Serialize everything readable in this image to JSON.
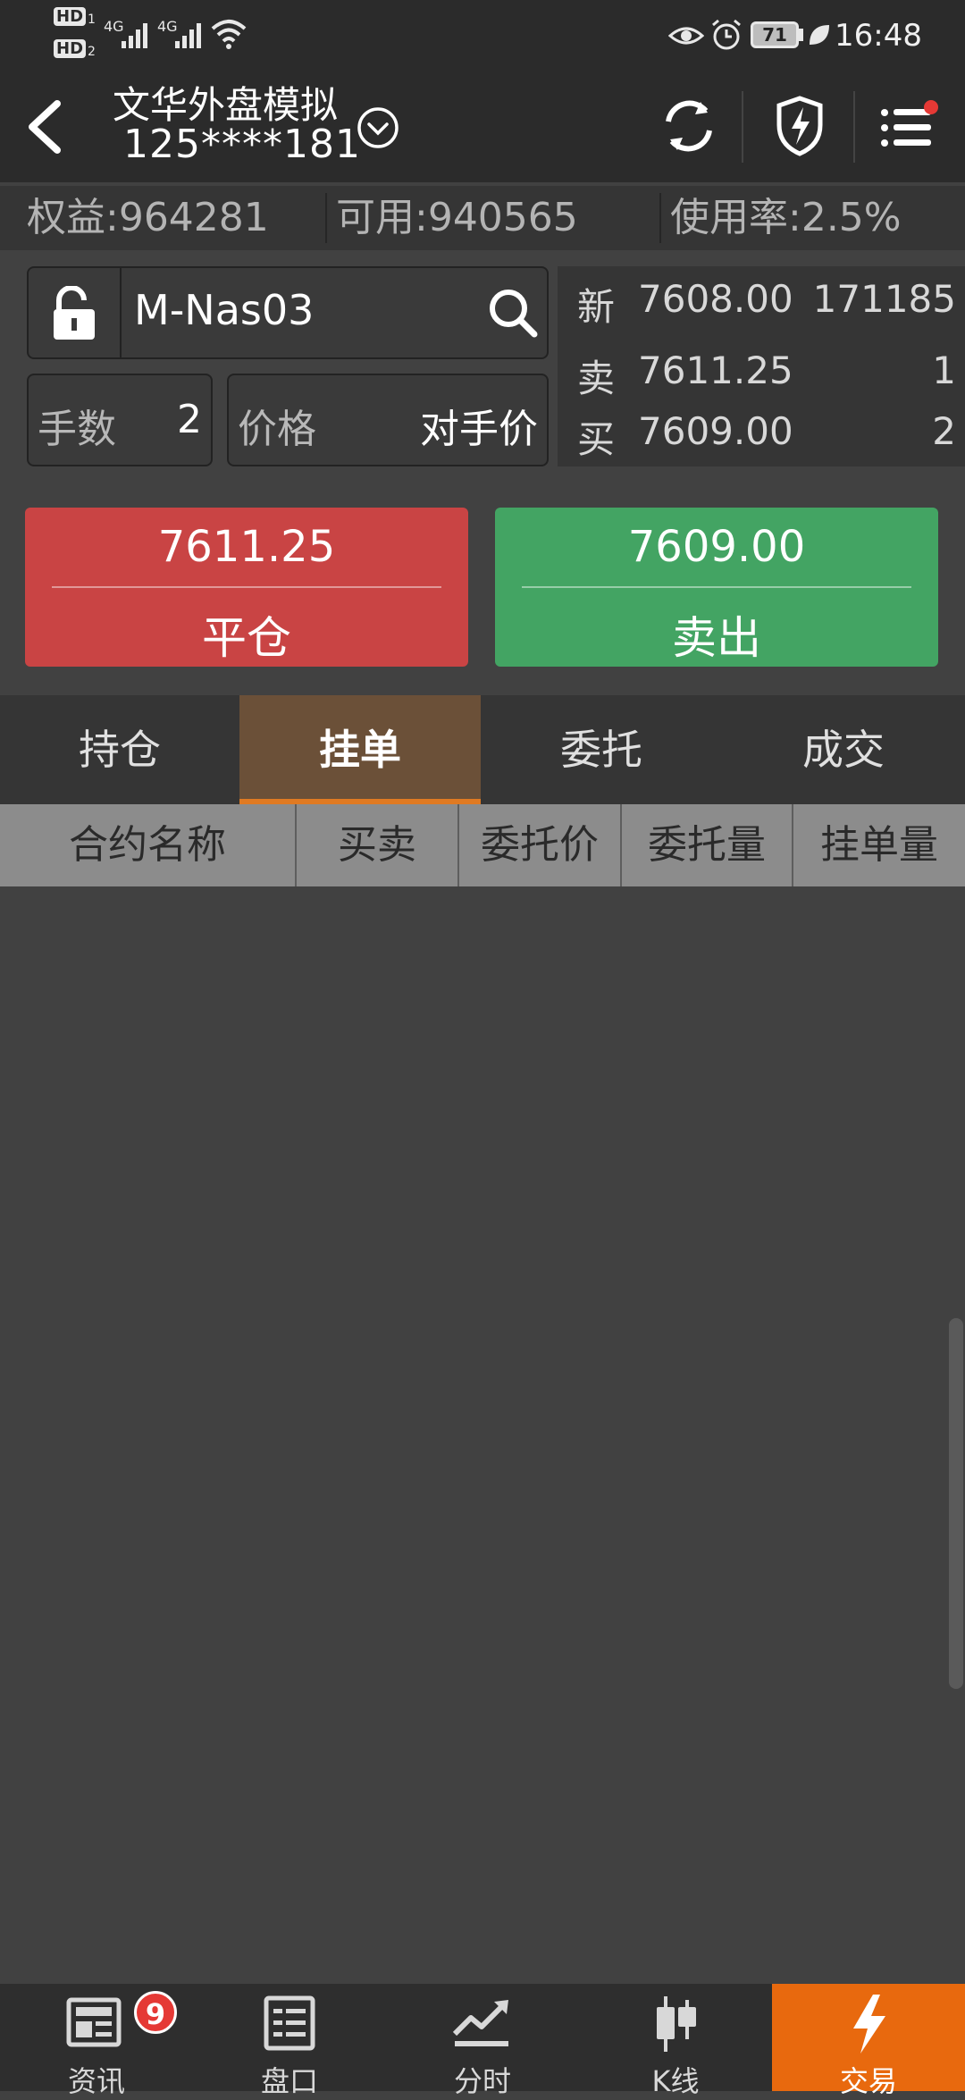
{
  "status_bar": {
    "hd1": "HD",
    "hd1_sub": "1",
    "hd2": "HD",
    "hd2_sub": "2",
    "net1": "4G",
    "net2": "4G",
    "battery": "71",
    "time": "16:48"
  },
  "header": {
    "title": "文华外盘模拟",
    "account": "125****181"
  },
  "account_bar": {
    "equity": "权益:964281",
    "available": "可用:940565",
    "usage": "使用率:2.5%"
  },
  "order": {
    "symbol": "M-Nas03",
    "lots_label": "手数",
    "lots_value": "2",
    "price_label": "价格",
    "price_value": "对手价"
  },
  "quote": {
    "last_label": "新",
    "last_price": "7608.00",
    "volume": "171185",
    "ask_label": "卖",
    "ask_price": "7611.25",
    "ask_qty": "1",
    "bid_label": "买",
    "bid_price": "7609.00",
    "bid_qty": "2"
  },
  "buttons": {
    "close_price": "7611.25",
    "close_label": "平仓",
    "sell_price": "7609.00",
    "sell_label": "卖出"
  },
  "tabs": [
    {
      "label": "持仓"
    },
    {
      "label": "挂单"
    },
    {
      "label": "委托"
    },
    {
      "label": "成交"
    }
  ],
  "active_tab": "挂单",
  "table": {
    "columns": [
      "合约名称",
      "买卖",
      "委托价",
      "委托量",
      "挂单量"
    ]
  },
  "bottom_nav": [
    {
      "label": "资讯",
      "icon": "news-icon",
      "badge": "9"
    },
    {
      "label": "盘口",
      "icon": "orderbook-icon"
    },
    {
      "label": "分时",
      "icon": "timeshare-icon"
    },
    {
      "label": "K线",
      "icon": "candlestick-icon"
    },
    {
      "label": "交易",
      "icon": "lightning-icon"
    }
  ],
  "colors": {
    "close_button": "#c94444",
    "sell_button": "#43a463",
    "active_tab": "#6b5038",
    "accent": "#e8690e"
  }
}
